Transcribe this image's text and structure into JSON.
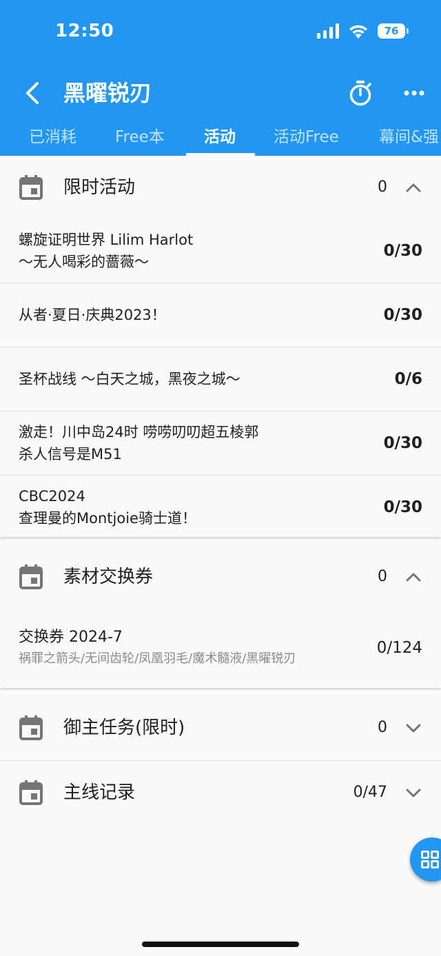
{
  "status": {
    "time": "12:50",
    "battery": "76"
  },
  "header": {
    "title": "黑曜锐刃"
  },
  "tabs": [
    "已消耗",
    "Free本",
    "活动",
    "活动Free",
    "幕间&强"
  ],
  "sections": {
    "limited": {
      "title": "限时活动",
      "count": "0",
      "items": [
        {
          "line1": "螺旋证明世界 Lilim Harlot",
          "line2": "～无人喝彩的蔷薇～",
          "value": "0/30"
        },
        {
          "line1": "从者·夏日·庆典2023！",
          "line2": "",
          "value": "0/30"
        },
        {
          "line1": "圣杯战线 ～白天之城，黑夜之城～",
          "line2": "",
          "value": "0/6"
        },
        {
          "line1": "激走！川中岛24时 唠唠叨叨超五棱郭",
          "line2": "杀人信号是M51",
          "value": "0/30"
        },
        {
          "line1": "CBC2024",
          "line2": "查理曼的Montjoie骑士道！",
          "value": "0/30"
        }
      ]
    },
    "exchange": {
      "title": "素材交换券",
      "count": "0",
      "items": [
        {
          "line1": "交换券 2024-7",
          "line2": "祸罪之箭头/无间齿轮/凤凰羽毛/魔术髓液/黑曜锐刃",
          "value": "0/124"
        }
      ]
    },
    "master": {
      "title": "御主任务(限时)",
      "count": "0"
    },
    "main": {
      "title": "主线记录",
      "count": "0/47"
    }
  },
  "colors": {
    "primary": "#2196f3",
    "background": "#fafafa"
  }
}
